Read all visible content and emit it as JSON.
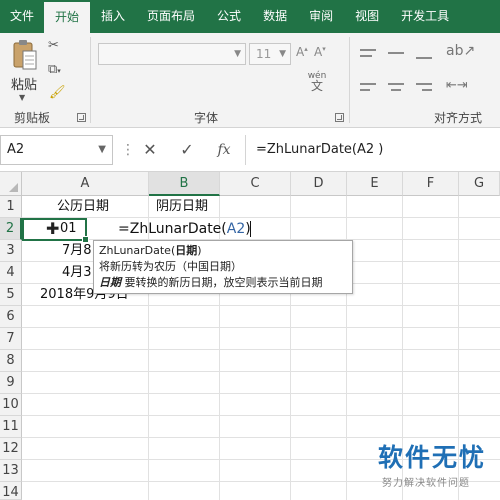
{
  "tabs": [
    "文件",
    "开始",
    "插入",
    "页面布局",
    "公式",
    "数据",
    "审阅",
    "视图",
    "开发工具"
  ],
  "active_tab": "开始",
  "ribbon": {
    "clipboard": {
      "paste_label": "粘贴",
      "group_label": "剪贴板"
    },
    "font": {
      "size_value": "11",
      "group_label": "字体",
      "phonetic_icon": "wén"
    },
    "alignment": {
      "group_label": "对齐方式"
    }
  },
  "formula_bar": {
    "name_box": "A2",
    "formula": "=ZhLunarDate(A2 )"
  },
  "grid": {
    "columns": [
      "A",
      "B",
      "C",
      "D",
      "E",
      "F",
      "G"
    ],
    "rows": [
      "1",
      "2",
      "3",
      "4",
      "5",
      "6",
      "7",
      "8",
      "9",
      "10",
      "11",
      "12",
      "13",
      "14"
    ],
    "cells": {
      "A1": "公历日期",
      "B1": "阴历日期",
      "A2": "01",
      "A3": "7月8",
      "A4": "4月3",
      "A5": "2018年9月9日"
    },
    "editing_formula_prefix": "=ZhLunarDate(",
    "editing_formula_ref": "A2",
    "editing_formula_suffix": ")"
  },
  "tooltip": {
    "func_name": "ZhLunarDate",
    "param": "日期",
    "description": "将新历转为农历（中国日期）",
    "param_label": "日期",
    "param_description": "要转换的新历日期，放空则表示当前日期"
  },
  "watermark": {
    "logo": "软件无忧",
    "subtitle": "努力解决软件问题"
  },
  "colors": {
    "excel_green": "#217346",
    "reference_blue": "#3465a4"
  }
}
